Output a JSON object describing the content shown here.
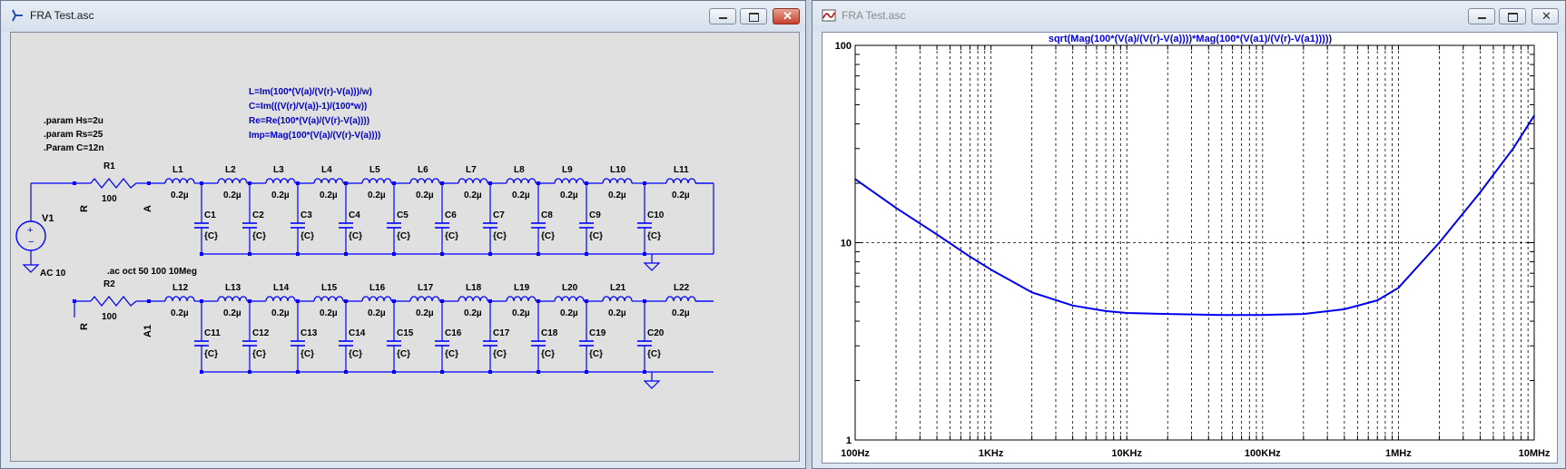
{
  "schematic_window": {
    "title": "FRA Test.asc",
    "params": [
      ".param Hs=2u",
      ".param Rs=25",
      ".Param C=12n"
    ],
    "formulas": [
      "L=Im(100*(V(a)/(V(r)-V(a)))/w)",
      "C=Im(((V(r)/V(a))-1)/(100*w))",
      "Re=Re(100*(V(a)/(V(r)-V(a))))",
      "Imp=Mag(100*(V(a)/(V(r)-V(a))))"
    ],
    "ac_directive": ".ac oct 50 100 10Meg",
    "source": {
      "name": "V1",
      "value": "AC 10"
    },
    "row1": {
      "resistor": "R1",
      "resistor_value": "100",
      "net_left": "R",
      "net_right": "A",
      "inductors": [
        "L1",
        "L2",
        "L3",
        "L4",
        "L5",
        "L6",
        "L7",
        "L8",
        "L9",
        "L10",
        "L11"
      ],
      "capacitors": [
        "C1",
        "C2",
        "C3",
        "C4",
        "C5",
        "C6",
        "C7",
        "C8",
        "C9",
        "C10"
      ]
    },
    "row2": {
      "resistor": "R2",
      "resistor_value": "100",
      "net_left": "R",
      "net_right": "A1",
      "inductors": [
        "L12",
        "L13",
        "L14",
        "L15",
        "L16",
        "L17",
        "L18",
        "L19",
        "L20",
        "L21",
        "L22"
      ],
      "capacitors": [
        "C11",
        "C12",
        "C13",
        "C14",
        "C15",
        "C16",
        "C17",
        "C18",
        "C19",
        "C20"
      ]
    },
    "inductor_value": "0.2µ",
    "capacitor_value": "{C}"
  },
  "plot_window": {
    "title": "FRA Test.asc",
    "trace_expression": "sqrt(Mag(100*(V(a)/(V(r)-V(a))))*Mag(100*(V(a1)/(V(r)-V(a1)))))"
  },
  "chart_data": {
    "type": "line",
    "title": "sqrt(Mag(100*(V(a)/(V(r)-V(a))))*Mag(100*(V(a1)/(V(r)-V(a1)))))",
    "xscale": "log",
    "yscale": "log",
    "xlim": [
      100,
      10000000
    ],
    "ylim": [
      1,
      100
    ],
    "xticks": [
      "100Hz",
      "1KHz",
      "10KHz",
      "100KHz",
      "1MHz",
      "10MHz"
    ],
    "yticks": [
      "100",
      "10",
      "1"
    ],
    "grid": true,
    "series": [
      {
        "color": "#0000ee",
        "x": [
          100,
          200,
          400,
          700,
          1000,
          2000,
          4000,
          7000,
          10000,
          20000,
          50000,
          100000,
          200000,
          400000,
          700000,
          1000000,
          2000000,
          4000000,
          7000000,
          10000000
        ],
        "y": [
          21,
          15,
          11,
          8.5,
          7.3,
          5.6,
          4.8,
          4.5,
          4.4,
          4.35,
          4.3,
          4.3,
          4.35,
          4.6,
          5.1,
          5.9,
          10,
          18,
          30,
          44
        ]
      }
    ]
  },
  "colors": {
    "wire": "#0000ff",
    "trace": "#0000ee",
    "schematic_bg": "#e0e0e0",
    "grid": "#000000"
  }
}
